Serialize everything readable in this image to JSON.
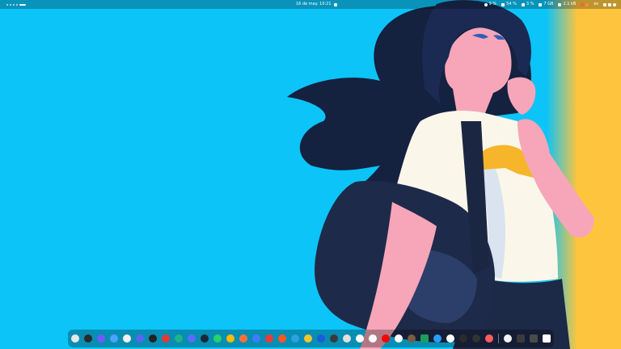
{
  "topbar": {
    "clock": "16 de may. 10:21",
    "status": {
      "brightness": "9 %",
      "battery": "54 %",
      "cpu": "3 %",
      "ram": "7 GB",
      "network": "2.1 kB"
    },
    "keyboard_layout": "es"
  },
  "dock": {
    "apps": [
      {
        "icon": "help-icon",
        "color": "#e8e8e8",
        "shape": "round"
      },
      {
        "icon": "terminal-icon",
        "color": "#2a2a2a",
        "shape": "round"
      },
      {
        "icon": "chat-icon",
        "color": "#6b5cff",
        "shape": "round"
      },
      {
        "icon": "settings-icon",
        "color": "#4aa3ff",
        "shape": "round"
      },
      {
        "icon": "browser-icon",
        "color": "#f2f2f2",
        "shape": "round"
      },
      {
        "icon": "discord-icon",
        "color": "#5865f2",
        "shape": "round"
      },
      {
        "icon": "github-icon",
        "color": "#222222",
        "shape": "round"
      },
      {
        "icon": "record-icon",
        "color": "#e53935",
        "shape": "round"
      },
      {
        "icon": "edge-icon",
        "color": "#1fb38a",
        "shape": "round"
      },
      {
        "icon": "gallery-icon",
        "color": "#5a6cff",
        "shape": "round"
      },
      {
        "icon": "steam-icon",
        "color": "#1b2838",
        "shape": "round"
      },
      {
        "icon": "whatsapp-icon",
        "color": "#25d366",
        "shape": "round"
      },
      {
        "icon": "chrome-icon",
        "color": "#fbbc05",
        "shape": "round"
      },
      {
        "icon": "firefox-icon",
        "color": "#ff7139",
        "shape": "round"
      },
      {
        "icon": "vpn-icon",
        "color": "#3d7dff",
        "shape": "round"
      },
      {
        "icon": "vivaldi-icon",
        "color": "#ef3939",
        "shape": "round"
      },
      {
        "icon": "brave-icon",
        "color": "#ff5722",
        "shape": "round"
      },
      {
        "icon": "telegram-icon",
        "color": "#2aa3e0",
        "shape": "round"
      },
      {
        "icon": "emoji-icon",
        "color": "#f4c430",
        "shape": "round"
      },
      {
        "icon": "bitwarden-icon",
        "color": "#175ddc",
        "shape": "round"
      },
      {
        "icon": "clock-icon",
        "color": "#3a3a3a",
        "shape": "round"
      },
      {
        "icon": "maps-icon",
        "color": "#e0e0e0",
        "shape": "round"
      },
      {
        "icon": "cloud-icon",
        "color": "#ffffff",
        "shape": "round"
      },
      {
        "icon": "add-icon",
        "color": "#ffffff",
        "shape": "round"
      },
      {
        "icon": "youtube-icon",
        "color": "#ff0000",
        "shape": "round"
      },
      {
        "icon": "notes-icon",
        "color": "#ffffff",
        "shape": "round"
      },
      {
        "icon": "gimp-icon",
        "color": "#7a5c40",
        "shape": "round"
      },
      {
        "icon": "zed-icon",
        "color": "#1e9e5e",
        "shape": "sq"
      },
      {
        "icon": "send-icon",
        "color": "#2a9dff",
        "shape": "round"
      },
      {
        "icon": "vlc-icon",
        "color": "#ffffff",
        "shape": "round"
      },
      {
        "icon": "code-icon",
        "color": "#2b2b2b",
        "shape": "round"
      },
      {
        "icon": "camera-icon",
        "color": "#333333",
        "shape": "round"
      },
      {
        "icon": "scratch-icon",
        "color": "#ff5c5c",
        "shape": "round"
      },
      {
        "icon": "fingerprint-icon",
        "color": "#f1f1f1",
        "shape": "round"
      },
      {
        "icon": "trash-icon",
        "color": "#3a3a3a",
        "shape": "sq"
      },
      {
        "icon": "files-icon",
        "color": "#4a4a4a",
        "shape": "sq"
      },
      {
        "icon": "app-grid-icon",
        "color": "#ffffff",
        "shape": "sq"
      }
    ]
  }
}
